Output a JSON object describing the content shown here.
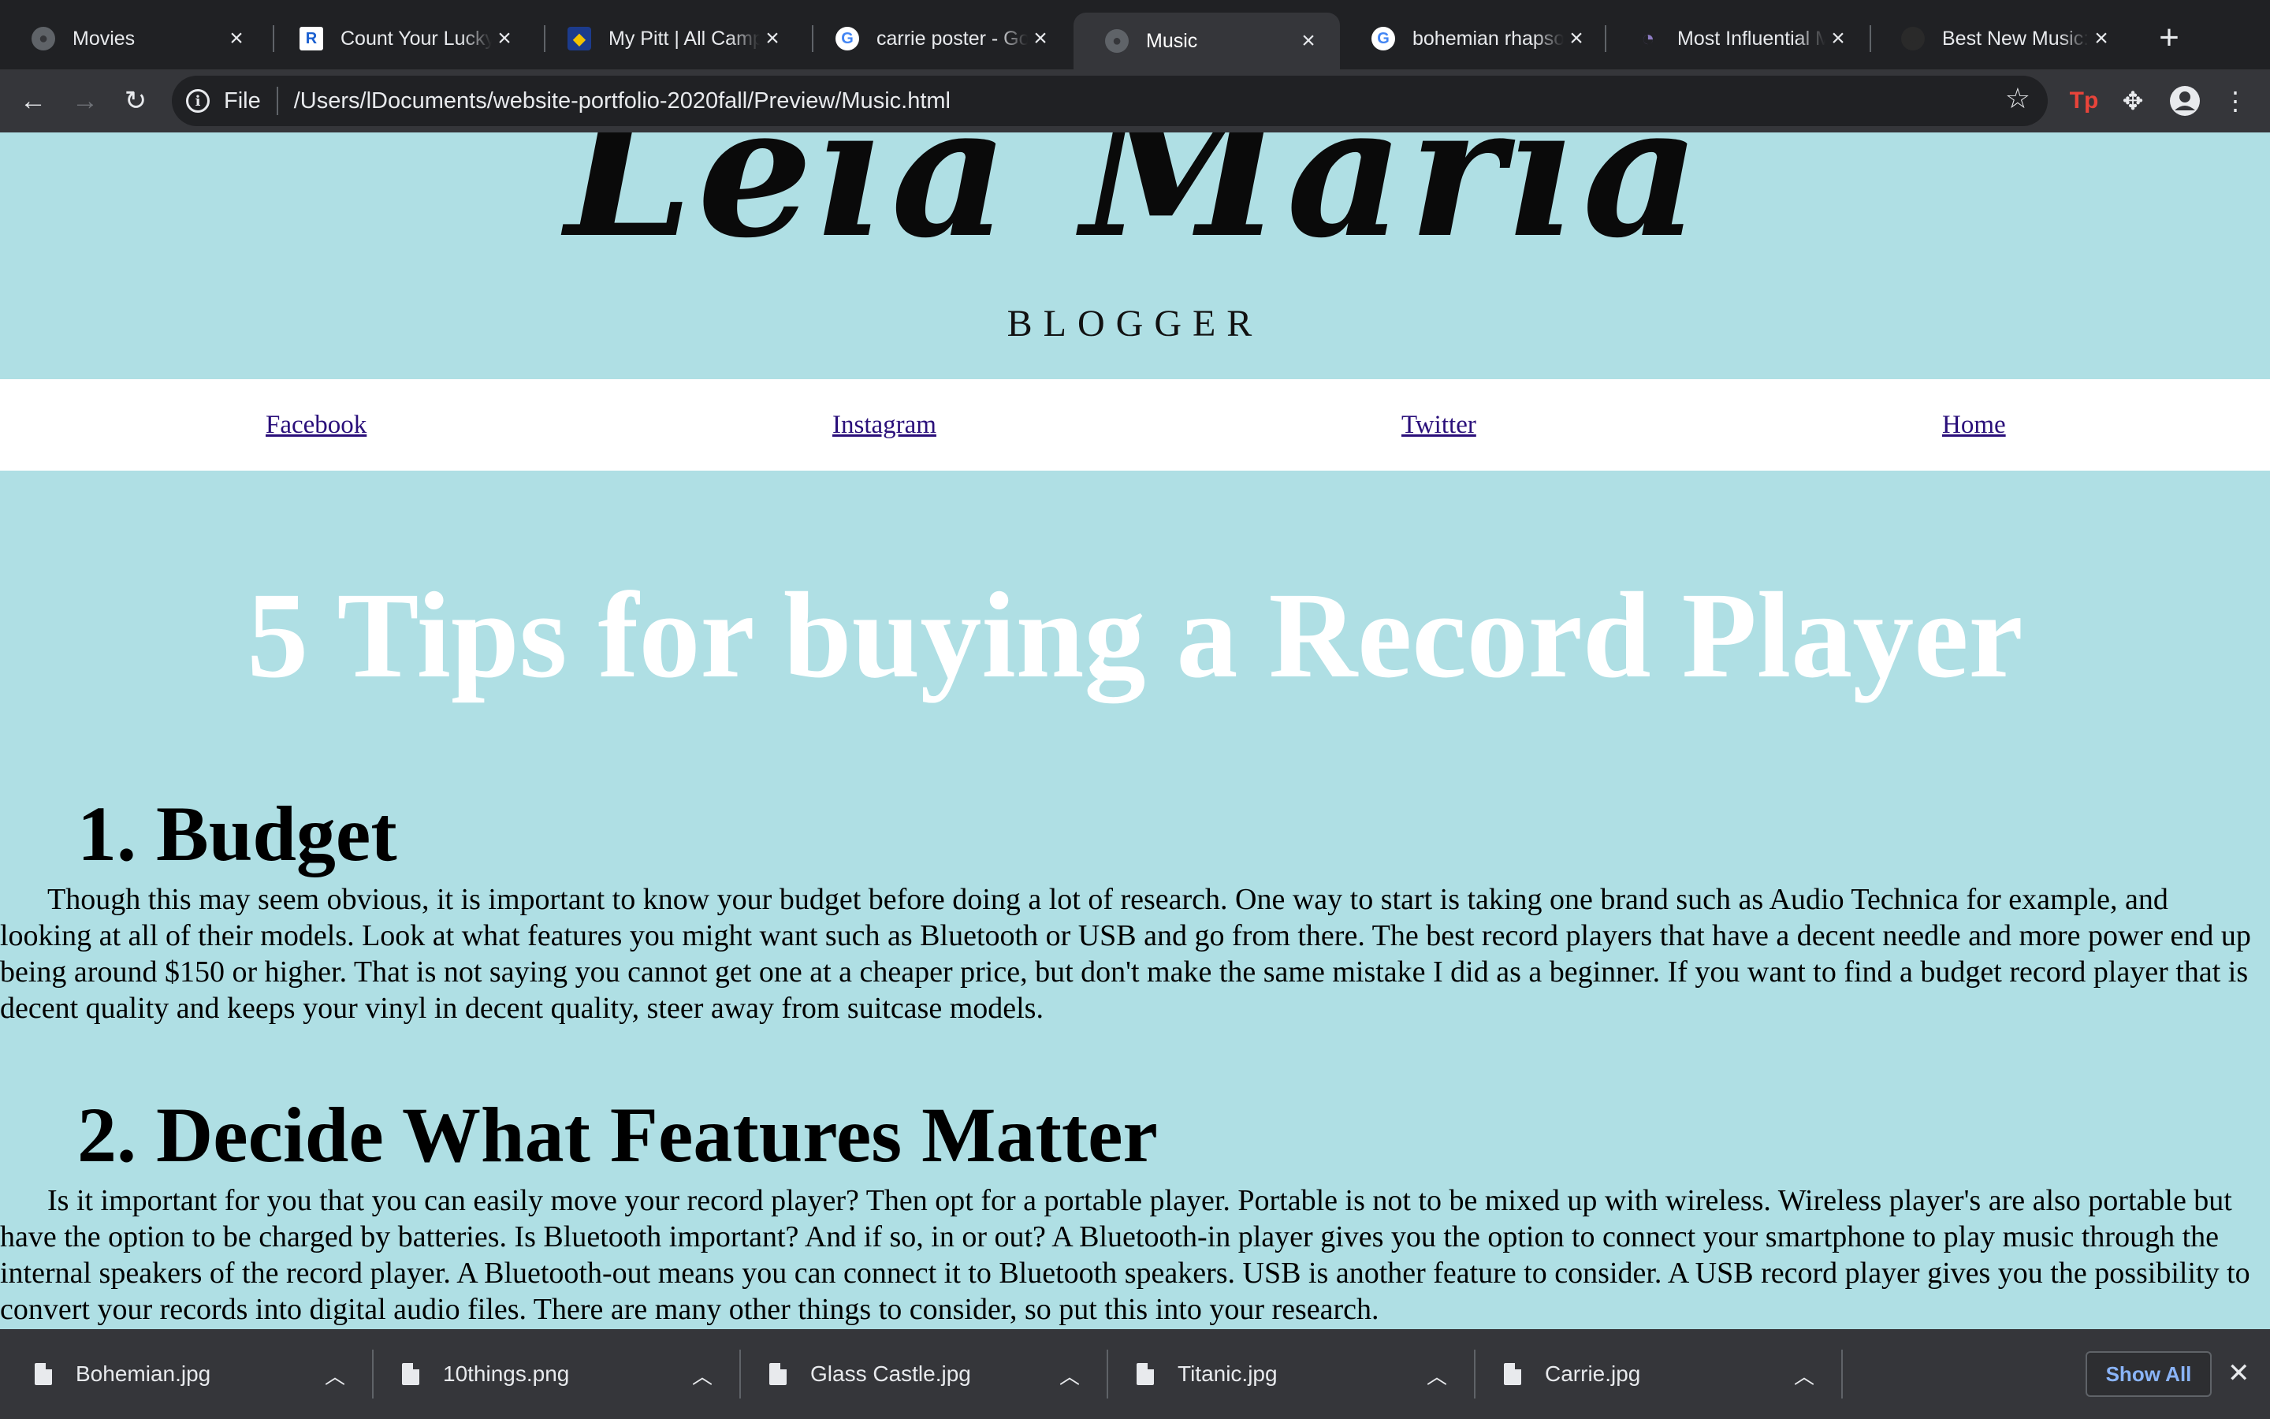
{
  "browser": {
    "tabs": [
      {
        "title": "Movies",
        "favicon": "globe-icon"
      },
      {
        "title": "Count Your Lucky",
        "favicon": "r-logo-icon"
      },
      {
        "title": "My Pitt | All Camp",
        "favicon": "pitt-shield-icon"
      },
      {
        "title": "carrie poster - Go",
        "favicon": "google-icon"
      },
      {
        "title": "Music",
        "favicon": "globe-icon",
        "active": true
      },
      {
        "title": "bohemian rhapsoc",
        "favicon": "google-icon"
      },
      {
        "title": "Most Influential M",
        "favicon": "rss-icon"
      },
      {
        "title": "Best New Music: T",
        "favicon": "dark-circle-icon"
      }
    ],
    "omnibox": {
      "scheme_label": "File",
      "url": "/Users/lDocuments/website-portfolio-2020fall/Preview/Music.html"
    },
    "extension_label": "Tp"
  },
  "site": {
    "logo": "Leia Maria",
    "subtitle": "BLOGGER",
    "nav": [
      "Facebook",
      "Instagram",
      "Twitter",
      "Home"
    ]
  },
  "article": {
    "title": "5 Tips for buying a Record Player",
    "sections": [
      {
        "heading": "1. Budget",
        "body": "Though this may seem obvious, it is important to know your budget before doing a lot of research. One way to start is taking one brand such as Audio Technica for example, and looking at all of their models. Look at what features you might want such as Bluetooth or USB and go from there. The best record players that have a decent needle and more power end up being around $150 or higher. That is not saying you cannot get one at a cheaper price, but don't make the same mistake I did as a beginner. If you want to find a budget record player that is decent quality and keeps your vinyl in decent quality, steer away from suitcase models."
      },
      {
        "heading": "2. Decide What Features Matter",
        "body": "Is it important for you that you can easily move your record player? Then opt for a portable player. Portable is not to be mixed up with wireless. Wireless player's are also portable but have the option to be charged by batteries. Is Bluetooth important? And if so, in or out? A Bluetooth-in player gives you the option to connect your smartphone to play music through the internal speakers of the record player. A Bluetooth-out means you can connect it to Bluetooth speakers. USB is another feature to consider. A USB record player gives you the possibility to convert your records into digital audio files. There are many other things to consider, so put this into your research."
      }
    ]
  },
  "downloads": {
    "files": [
      "Bohemian.jpg",
      "10things.png",
      "Glass Castle.jpg",
      "Titanic.jpg",
      "Carrie.jpg"
    ],
    "show_all_label": "Show All"
  },
  "colors": {
    "page_background": "#afdfe4",
    "headline_text": "#ffffff",
    "nav_link": "#2a0f7a",
    "chrome_dark": "#202124",
    "chrome_mid": "#35363a"
  }
}
